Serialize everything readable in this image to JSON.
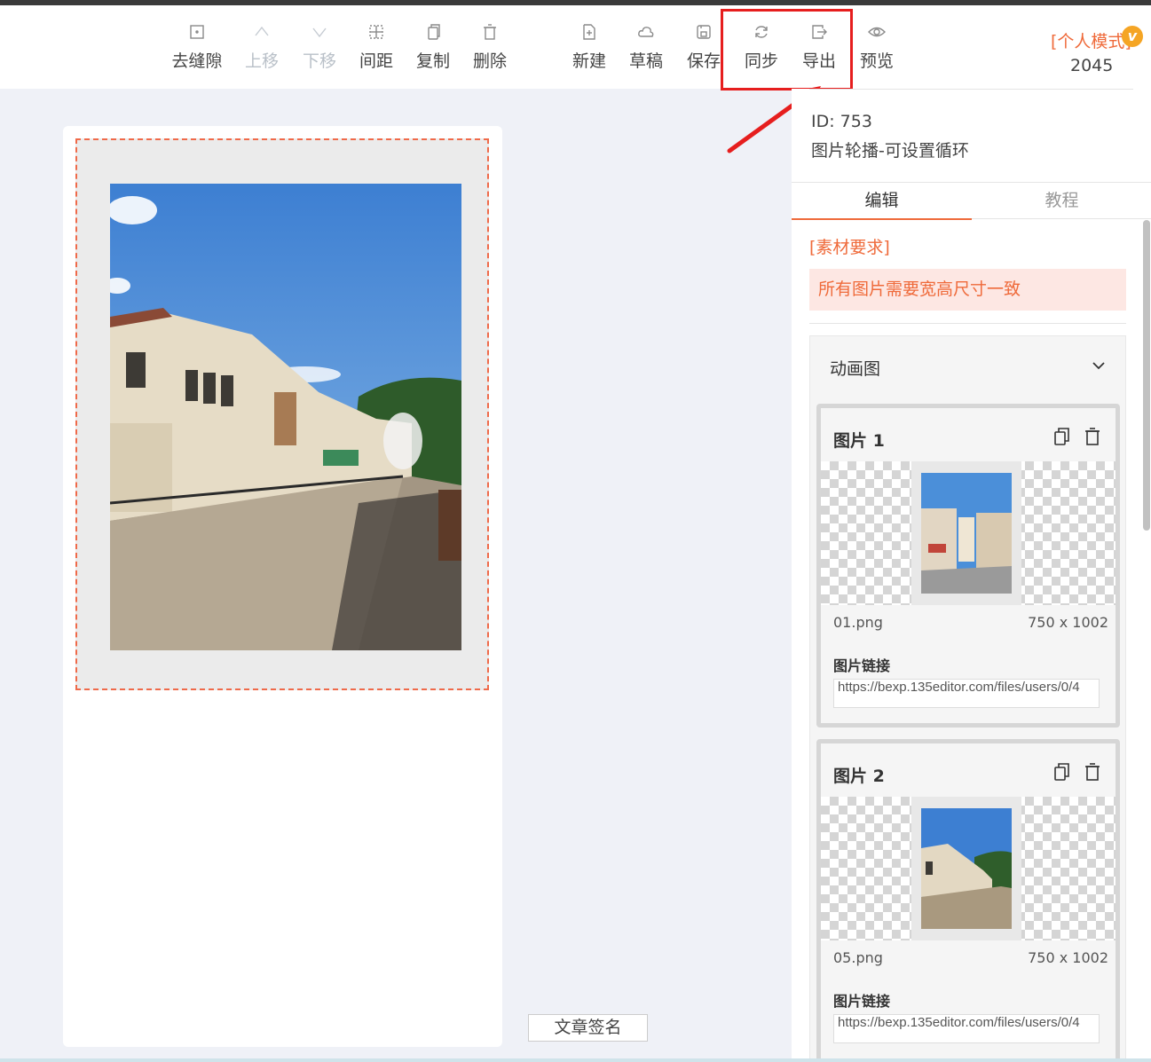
{
  "toolbar": {
    "buttons": [
      {
        "label": "去缝隙",
        "icon": "grid-dot-icon"
      },
      {
        "label": "上移",
        "icon": "chevron-up-icon"
      },
      {
        "label": "下移",
        "icon": "chevron-down-icon"
      },
      {
        "label": "间距",
        "icon": "spacing-icon"
      },
      {
        "label": "复制",
        "icon": "copy-icon"
      },
      {
        "label": "删除",
        "icon": "trash-icon"
      },
      {
        "label": "新建",
        "icon": "new-file-icon"
      },
      {
        "label": "草稿",
        "icon": "cloud-icon"
      },
      {
        "label": "保存",
        "icon": "save-icon"
      },
      {
        "label": "同步",
        "icon": "sync-icon"
      },
      {
        "label": "导出",
        "icon": "export-icon"
      },
      {
        "label": "预览",
        "icon": "eye-icon"
      }
    ],
    "mode": "[个人模式]",
    "vip_badge": "v",
    "count": "2045"
  },
  "template": {
    "id": "ID: 753",
    "name": "图片轮播-可设置循环"
  },
  "tabs": [
    "编辑",
    "教程"
  ],
  "requirements": {
    "title": "[素材要求]",
    "text": "所有图片需要宽高尺寸一致"
  },
  "animation": {
    "title": "动画图",
    "cards": [
      {
        "title": "图片 1",
        "filename": "01.png",
        "dims": "750 x 1002",
        "link_label": "图片链接",
        "link_value": "https://bexp.135editor.com/files/users/0/4"
      },
      {
        "title": "图片 2",
        "filename": "05.png",
        "dims": "750 x 1002",
        "link_label": "图片链接",
        "link_value": "https://bexp.135editor.com/files/users/0/4"
      }
    ]
  },
  "signature": "文章签名",
  "colors": {
    "accent": "#ef6a3a",
    "highlight": "#e61e1e",
    "canvas_bg": "#eff1f7"
  }
}
